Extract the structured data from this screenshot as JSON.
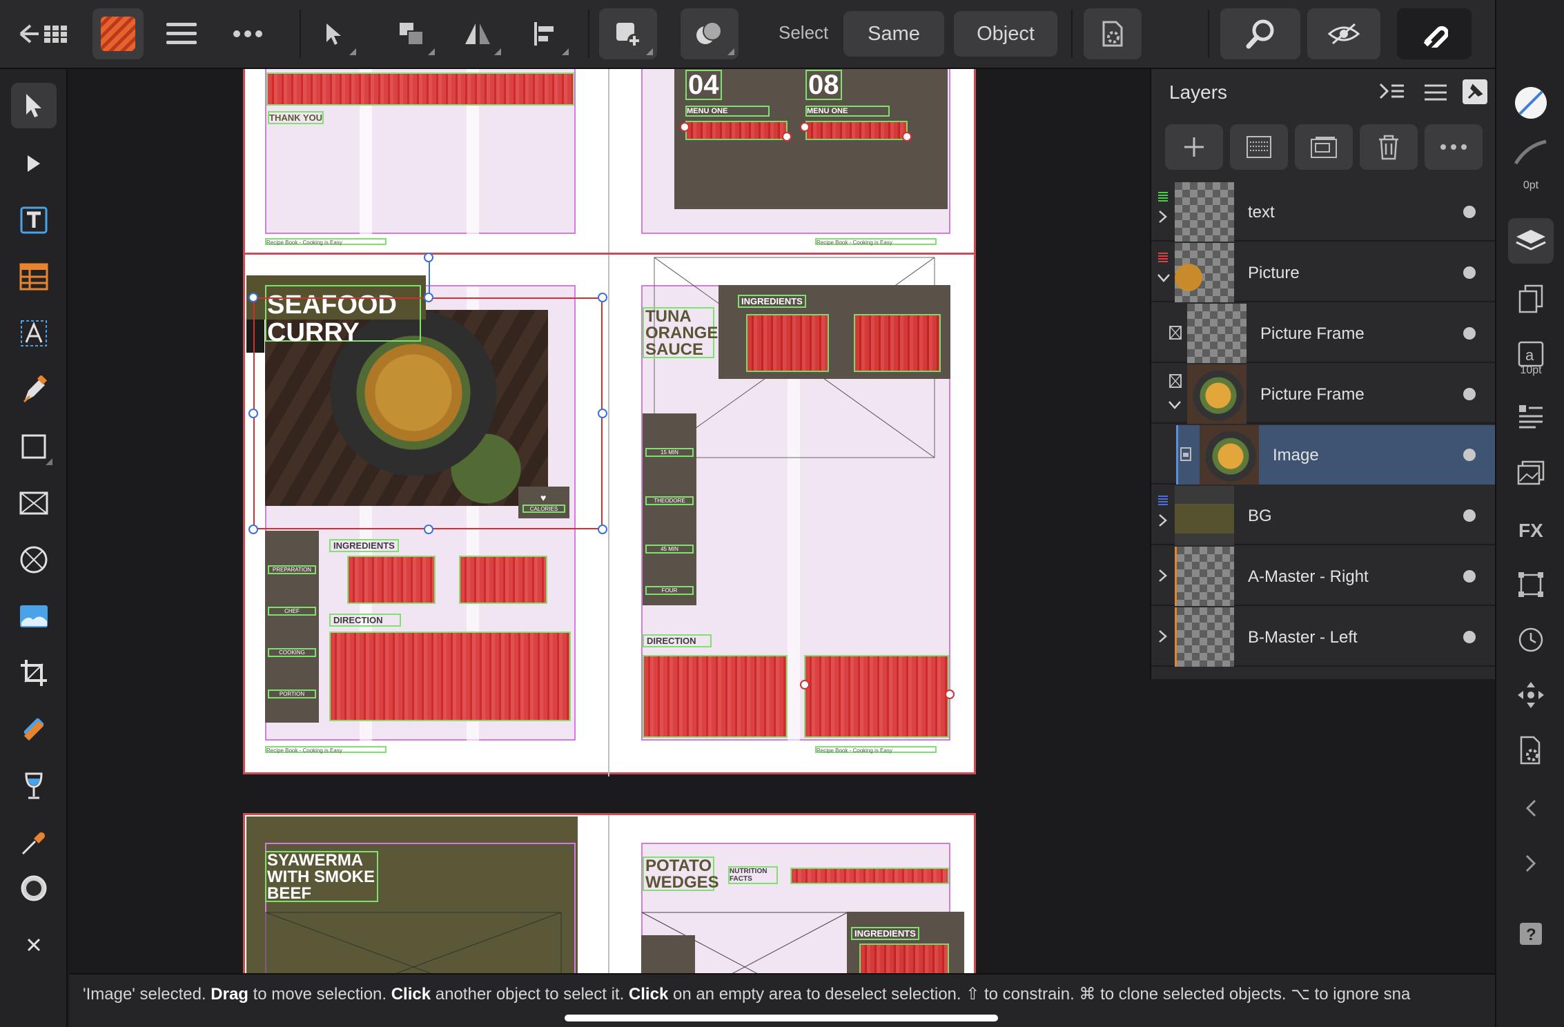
{
  "toolbar": {
    "select_label": "Select",
    "same_label": "Same",
    "object_label": "Object"
  },
  "icons": {
    "back": "back-grid-icon",
    "app": "publisher-persona-icon",
    "menu": "hamburger-menu-icon",
    "more": "ellipsis-icon",
    "move": "move-tool-icon",
    "arrange": "arrange-icon",
    "flip": "flip-icon",
    "align": "align-icon",
    "insert": "insert-icon",
    "boolean": "boolean-icon",
    "settings": "selection-settings-icon",
    "zoom": "zoom-icon",
    "view": "view-mode-icon",
    "snap": "snapping-icon",
    "studio": "studio-toggle-icon"
  },
  "layers_panel": {
    "title": "Layers",
    "rows": [
      {
        "name": "text",
        "indent": 0,
        "expandable": true,
        "expanded": false,
        "selected": false
      },
      {
        "name": "Picture",
        "indent": 0,
        "expandable": true,
        "expanded": true,
        "selected": false
      },
      {
        "name": "Picture Frame",
        "indent": 1,
        "expandable": false,
        "expanded": false,
        "selected": false
      },
      {
        "name": "Picture Frame",
        "indent": 1,
        "expandable": true,
        "expanded": true,
        "selected": false
      },
      {
        "name": "Image",
        "indent": 2,
        "expandable": false,
        "expanded": false,
        "selected": true
      },
      {
        "name": "BG",
        "indent": 0,
        "expandable": true,
        "expanded": false,
        "selected": false
      },
      {
        "name": "A-Master - Right",
        "indent": 0,
        "expandable": true,
        "expanded": false,
        "selected": false
      },
      {
        "name": "B-Master - Left",
        "indent": 0,
        "expandable": true,
        "expanded": false,
        "selected": false
      }
    ]
  },
  "studio": {
    "stroke_width": "0pt",
    "font_size": "10pt"
  },
  "document": {
    "footer": "Recipe Book - Cooking is Easy",
    "menu_numbers": [
      "04",
      "08"
    ],
    "menu_one": "MENU ONE",
    "thank_you": "THANK YOU",
    "recipes": [
      {
        "title_line1": "SEAFOOD",
        "title_line2": "CURRY"
      },
      {
        "title_line1": "TUNA",
        "title_line2": "ORANGE",
        "title_line3": "SAUCE"
      },
      {
        "title_line1": "SYAWERMA",
        "title_line2": "WITH SMOKE",
        "title_line3": "BEEF"
      },
      {
        "title_line1": "POTATO",
        "title_line2": "WEDGES"
      }
    ],
    "ingredients": "INGREDIENTS",
    "direction": "DIRECTION",
    "nutrition_facts": "NUTRITION FACTS",
    "calories": "CALORIES",
    "side_labels": [
      "PREPARATION",
      "15 MIN",
      "CHEF",
      "THEODORE",
      "COOKING",
      "45 MIN",
      "PORTION",
      "FOUR"
    ]
  },
  "status": {
    "part1": "'Image' selected. ",
    "drag": "Drag",
    "part2": " to move selection. ",
    "click1": "Click",
    "part3": " another object to select it. ",
    "click2": "Click",
    "part4": " on an empty area to deselect selection. ⇧ to constrain. ⌘ to clone selected objects. ⌥ to ignore sna"
  }
}
